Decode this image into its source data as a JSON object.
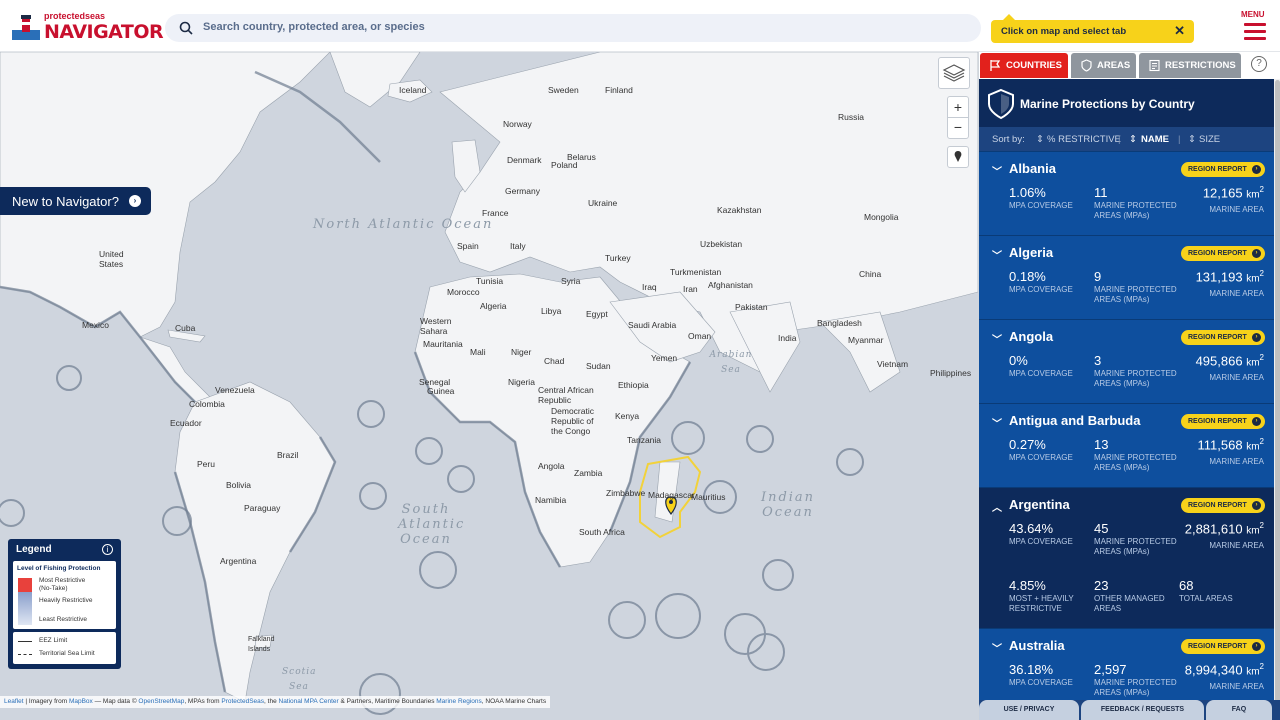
{
  "header": {
    "logo_sub": "protectedseas",
    "logo_main": "NAVIGATOR",
    "search_placeholder": "Search country, protected area, or species",
    "tip_text": "Click on map and select tab",
    "menu_label": "MENU"
  },
  "map": {
    "new_to_navigator": "New to Navigator?",
    "labels": [
      "Iceland",
      "Sweden",
      "Finland",
      "Norway",
      "Russia",
      "Denmark",
      "Belarus",
      "Poland",
      "Germany",
      "Ukraine",
      "France",
      "Kazakhstan",
      "Mongolia",
      "Spain",
      "Italy",
      "Uzbekistan",
      "Turkey",
      "Tunisia",
      "Syria",
      "Turkmenistan",
      "Afghanistan",
      "Iraq",
      "Iran",
      "Morocco",
      "Western Sahara",
      "Algeria",
      "Libya",
      "Egypt",
      "Pakistan",
      "China",
      "Saudi Arabia",
      "Oman",
      "India",
      "Bangladesh",
      "Myanmar",
      "Mauritania",
      "Mali",
      "Niger",
      "Chad",
      "Sudan",
      "Yemen",
      "Senegal",
      "Guinea",
      "Nigeria",
      "Ethiopia",
      "Vietnam",
      "Philippines",
      "Central African Republic",
      "Democratic Republic of the Congo",
      "Kenya",
      "Tanzania",
      "Angola",
      "Zambia",
      "Namibia",
      "Zimbabwe",
      "Madagascar",
      "Mauritius",
      "South Africa",
      "United States",
      "Mexico",
      "Cuba",
      "Venezuela",
      "Colombia",
      "Ecuador",
      "Peru",
      "Brazil",
      "Bolivia",
      "Paraguay",
      "Argentina",
      "Falkland Islands"
    ],
    "oceans": [
      "North Atlantic Ocean",
      "South Atlantic Ocean",
      "Indian Ocean",
      "Arabian Sea",
      "Scotia Sea"
    ],
    "legend": {
      "title": "Legend",
      "section": "Level of Fishing Protection",
      "most": "Most Restrictive",
      "most_sub": "(No-Take)",
      "heavily": "Heavily Restrictive",
      "least": "Least Restrictive",
      "eez": "EEZ Limit",
      "territorial": "Territorial Sea Limit",
      "colors": {
        "most": "#e8413c",
        "heavily": "#8a9fcb",
        "least": "#dfe6f3"
      }
    },
    "attribution": {
      "leaflet": "Leaflet",
      "text1": " | Imagery from ",
      "mapbox": "MapBox",
      "text2": " — Map data © ",
      "osm": "OpenStreetMap",
      "text3": ", MPAs from ",
      "ps": "ProtectedSeas",
      "text4": ", the ",
      "nmc": "National MPA Center",
      "text5": " & Partners, Maritime Boundaries ",
      "mr": "Marine Regions",
      "text6": ", NOAA Marine Charts"
    }
  },
  "panel": {
    "tabs": [
      "COUNTRIES",
      "AREAS",
      "RESTRICTIONS"
    ],
    "title": "Marine Protections by Country",
    "sort_label": "Sort by:",
    "sort_options": [
      "% RESTRICTIVE",
      "NAME",
      "SIZE"
    ],
    "region_report": "REGION REPORT",
    "countries": [
      {
        "name": "Albania",
        "coverage": "1.06%",
        "coverage_label": "MPA COVERAGE",
        "mpas": "11",
        "mpas_label": "MARINE PROTECTED AREAS (MPAs)",
        "area": "12,165",
        "area_unit": "km",
        "area_label": "MARINE AREA"
      },
      {
        "name": "Algeria",
        "coverage": "0.18%",
        "coverage_label": "MPA COVERAGE",
        "mpas": "9",
        "mpas_label": "MARINE PROTECTED AREAS (MPAs)",
        "area": "131,193",
        "area_unit": "km",
        "area_label": "MARINE AREA"
      },
      {
        "name": "Angola",
        "coverage": "0%",
        "coverage_label": "MPA COVERAGE",
        "mpas": "3",
        "mpas_label": "MARINE PROTECTED AREAS (MPAs)",
        "area": "495,866",
        "area_unit": "km",
        "area_label": "MARINE AREA"
      },
      {
        "name": "Antigua and Barbuda",
        "coverage": "0.27%",
        "coverage_label": "MPA COVERAGE",
        "mpas": "13",
        "mpas_label": "MARINE PROTECTED AREAS (MPAs)",
        "area": "111,568",
        "area_unit": "km",
        "area_label": "MARINE AREA"
      },
      {
        "name": "Argentina",
        "coverage": "43.64%",
        "coverage_label": "MPA COVERAGE",
        "mpas": "45",
        "mpas_label": "MARINE PROTECTED AREAS (MPAs)",
        "area": "2,881,610",
        "area_unit": "km",
        "area_label": "MARINE AREA",
        "extra": {
          "heavy": "4.85%",
          "heavy_label": "MOST + HEAVILY RESTRICTIVE",
          "other": "23",
          "other_label": "OTHER MANAGED AREAS",
          "total": "68",
          "total_label": "TOTAL AREAS"
        }
      },
      {
        "name": "Australia",
        "coverage": "36.18%",
        "coverage_label": "MPA COVERAGE",
        "mpas": "2,597",
        "mpas_label": "MARINE PROTECTED AREAS (MPAs)",
        "area": "8,994,340",
        "area_unit": "km",
        "area_label": "MARINE AREA"
      }
    ],
    "footer": [
      "USE / PRIVACY",
      "FEEDBACK / REQUESTS",
      "FAQ"
    ]
  }
}
